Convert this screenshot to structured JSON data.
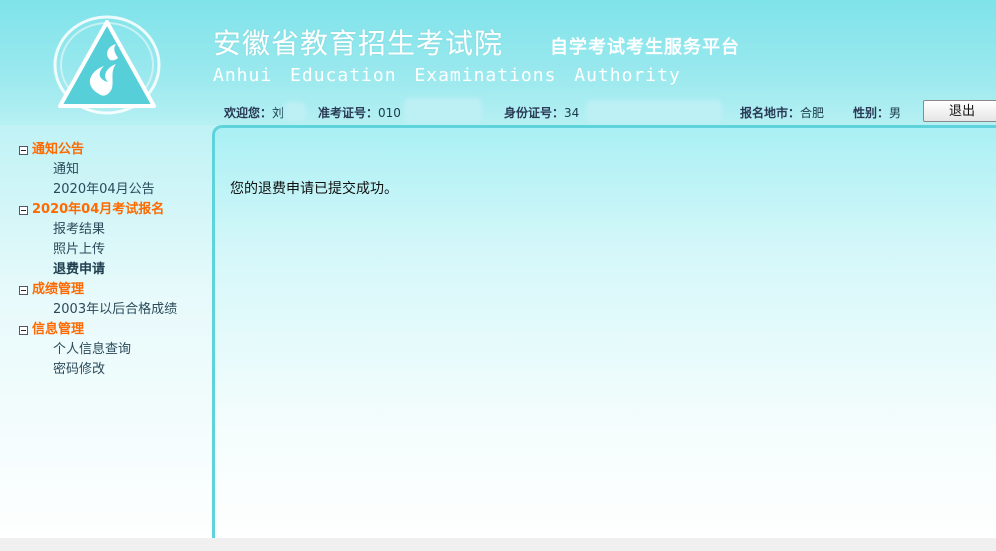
{
  "header": {
    "title_cn": "安徽省教育招生考试院",
    "subtitle_cn": "自学考试考生服务平台",
    "title_en": "Anhui Education Examinations Authority",
    "logo": "triangle-flame-logo"
  },
  "user_info": {
    "welcome_label": "欢迎您：",
    "welcome_value": "刘",
    "exam_id_label": "准考证号：",
    "exam_id_value": "010",
    "id_card_label": "身份证号：",
    "id_card_value": "34",
    "location_label": "报名地市：",
    "location_value": "合肥",
    "gender_label": "性别：",
    "gender_value": "男",
    "logout_label": "退出"
  },
  "sidebar": {
    "groups": [
      {
        "label": "通知公告",
        "items": [
          "通知",
          "2020年04月公告"
        ]
      },
      {
        "label": "2020年04月考试报名",
        "items": [
          "报考结果",
          "照片上传",
          "退费申请"
        ]
      },
      {
        "label": "成绩管理",
        "items": [
          "2003年以后合格成绩"
        ]
      },
      {
        "label": "信息管理",
        "items": [
          "个人信息查询",
          "密码修改"
        ]
      }
    ],
    "active_item": "退费申请"
  },
  "main": {
    "message": "您的退费申请已提交成功。"
  },
  "colors": {
    "header_bg": "#9ae9ee",
    "accent_orange": "#ff6a00",
    "content_border": "#5ed3dc"
  }
}
